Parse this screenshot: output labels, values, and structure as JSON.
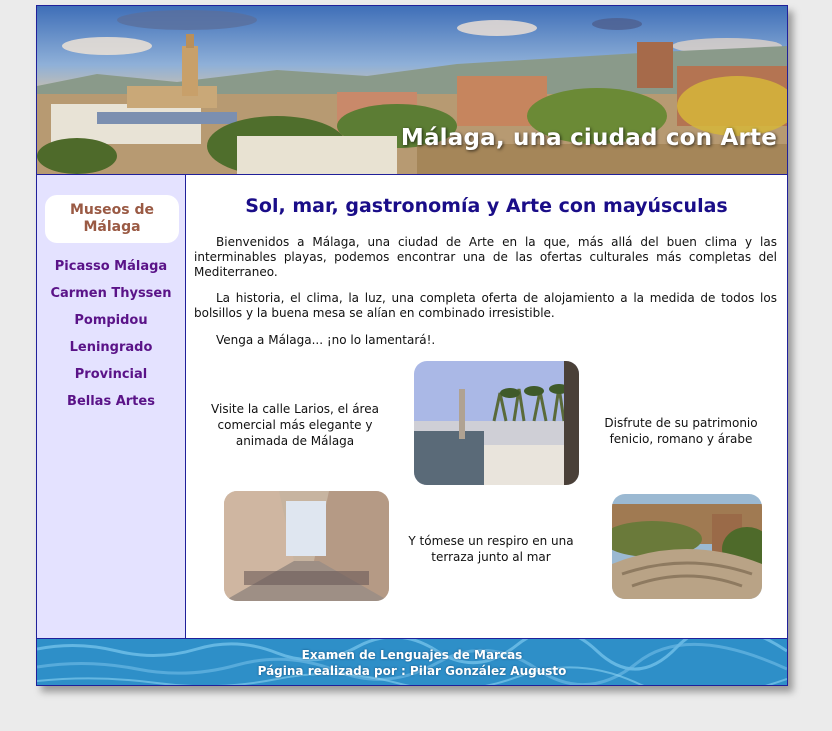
{
  "header": {
    "title": "Málaga, una ciudad con Arte"
  },
  "sidebar": {
    "title": "Museos de Málaga",
    "links": [
      "Picasso Málaga",
      "Carmen Thyssen",
      "Pompidou",
      "Leningrado",
      "Provincial",
      "Bellas Artes"
    ]
  },
  "main": {
    "title": "Sol, mar, gastronomía y Arte con mayúsculas",
    "paragraphs": [
      "Bienvenidos a Málaga, una ciudad de Arte en la que, más allá del buen clima y las interminables playas, podemos encontrar una de las ofertas culturales más completas del Mediterraneo.",
      "La historia, el clima, la luz, una completa oferta de alojamiento a la medida de todos los bolsillos y la buena mesa se alían en combinado irresistible.",
      "Venga a Málaga... ¡no lo lamentará!."
    ],
    "captions": {
      "larios": "Visite la calle Larios, el área comercial más elegante y animada de Málaga",
      "patrimonio": "Disfrute de su patrimonio fenicio, romano y árabe",
      "terraza": "Y tómese un respiro en una terraza junto al mar"
    }
  },
  "footer": {
    "line1": "Examen de Lenguajes de Marcas",
    "line2": "Página realizada por : Pilar González Augusto"
  },
  "colors": {
    "border": "#20209a",
    "sidebar_bg": "#e4e2ff",
    "link": "#5a1388",
    "side_title": "#9a5a44",
    "main_title": "#1a0d88"
  }
}
